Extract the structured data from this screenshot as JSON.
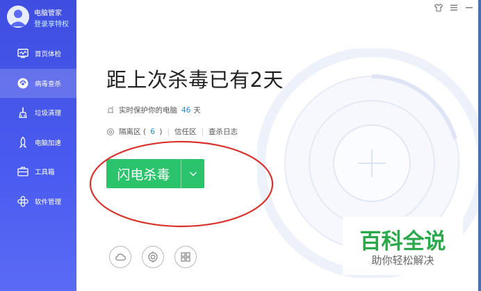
{
  "profile": {
    "app_name": "电脑管家",
    "vip_link": "登录享特权"
  },
  "nav": {
    "items": [
      {
        "label": "首页体检",
        "icon": "monitor-icon"
      },
      {
        "label": "病毒查杀",
        "icon": "shield-virus-icon",
        "active": true
      },
      {
        "label": "垃圾清理",
        "icon": "broom-icon"
      },
      {
        "label": "电脑加速",
        "icon": "rocket-icon"
      },
      {
        "label": "工具箱",
        "icon": "toolbox-icon"
      },
      {
        "label": "软件管理",
        "icon": "apps-icon"
      }
    ]
  },
  "window_controls": {
    "skin": "shirt-icon",
    "menu": "menu-icon",
    "minimize": "minimize-icon"
  },
  "main": {
    "headline": "距上次杀毒已有2天",
    "protect": {
      "label": "实时保护你的电脑",
      "days": "46",
      "unit": "天"
    },
    "links": {
      "quarantine_label": "隔离区",
      "quarantine_open": "(",
      "quarantine_count": "6",
      "quarantine_close": ")",
      "trust_label": "信任区",
      "log_label": "查杀日志",
      "separator": "|"
    },
    "scan_button": "闪电杀毒",
    "tools": [
      "cloud-icon",
      "target-icon",
      "grid-icon"
    ]
  },
  "watermark": {
    "title": "百科全说",
    "subtitle": "助你轻松解决"
  },
  "colors": {
    "sidebar": "#4a5cf0",
    "scan_green": "#2bc36b",
    "accent_blue": "#1a8dd6",
    "annotation_red": "#d9322c",
    "watermark_green": "#2aa84a"
  }
}
